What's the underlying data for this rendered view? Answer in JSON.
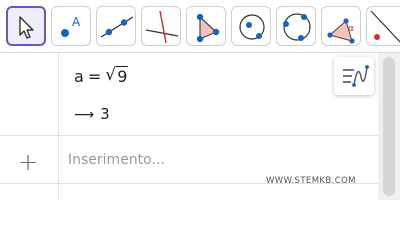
{
  "toolbar": {
    "tools": [
      {
        "icon": "move-arrow-icon",
        "selected": true
      },
      {
        "icon": "point-icon",
        "label": "A"
      },
      {
        "icon": "line-icon"
      },
      {
        "icon": "perpendicular-line-icon"
      },
      {
        "icon": "polygon-icon"
      },
      {
        "icon": "circle-center-point-icon"
      },
      {
        "icon": "circle-through-points-icon"
      },
      {
        "icon": "angle-icon",
        "label": "α"
      },
      {
        "icon": "reflect-icon"
      }
    ],
    "colors": {
      "accent": "#6557d2",
      "point": "#1565c0",
      "red": "#d32f2f",
      "polygon_fill": "#f4c2bd"
    }
  },
  "algebra": {
    "definition": {
      "var": "a",
      "op": "=",
      "radicand": "9"
    },
    "output": {
      "arrow": "⟶",
      "value": "3"
    },
    "input": {
      "plus": "+",
      "placeholder": "Inserimento..."
    }
  },
  "watermark": "WWW.STEMKB.COM"
}
